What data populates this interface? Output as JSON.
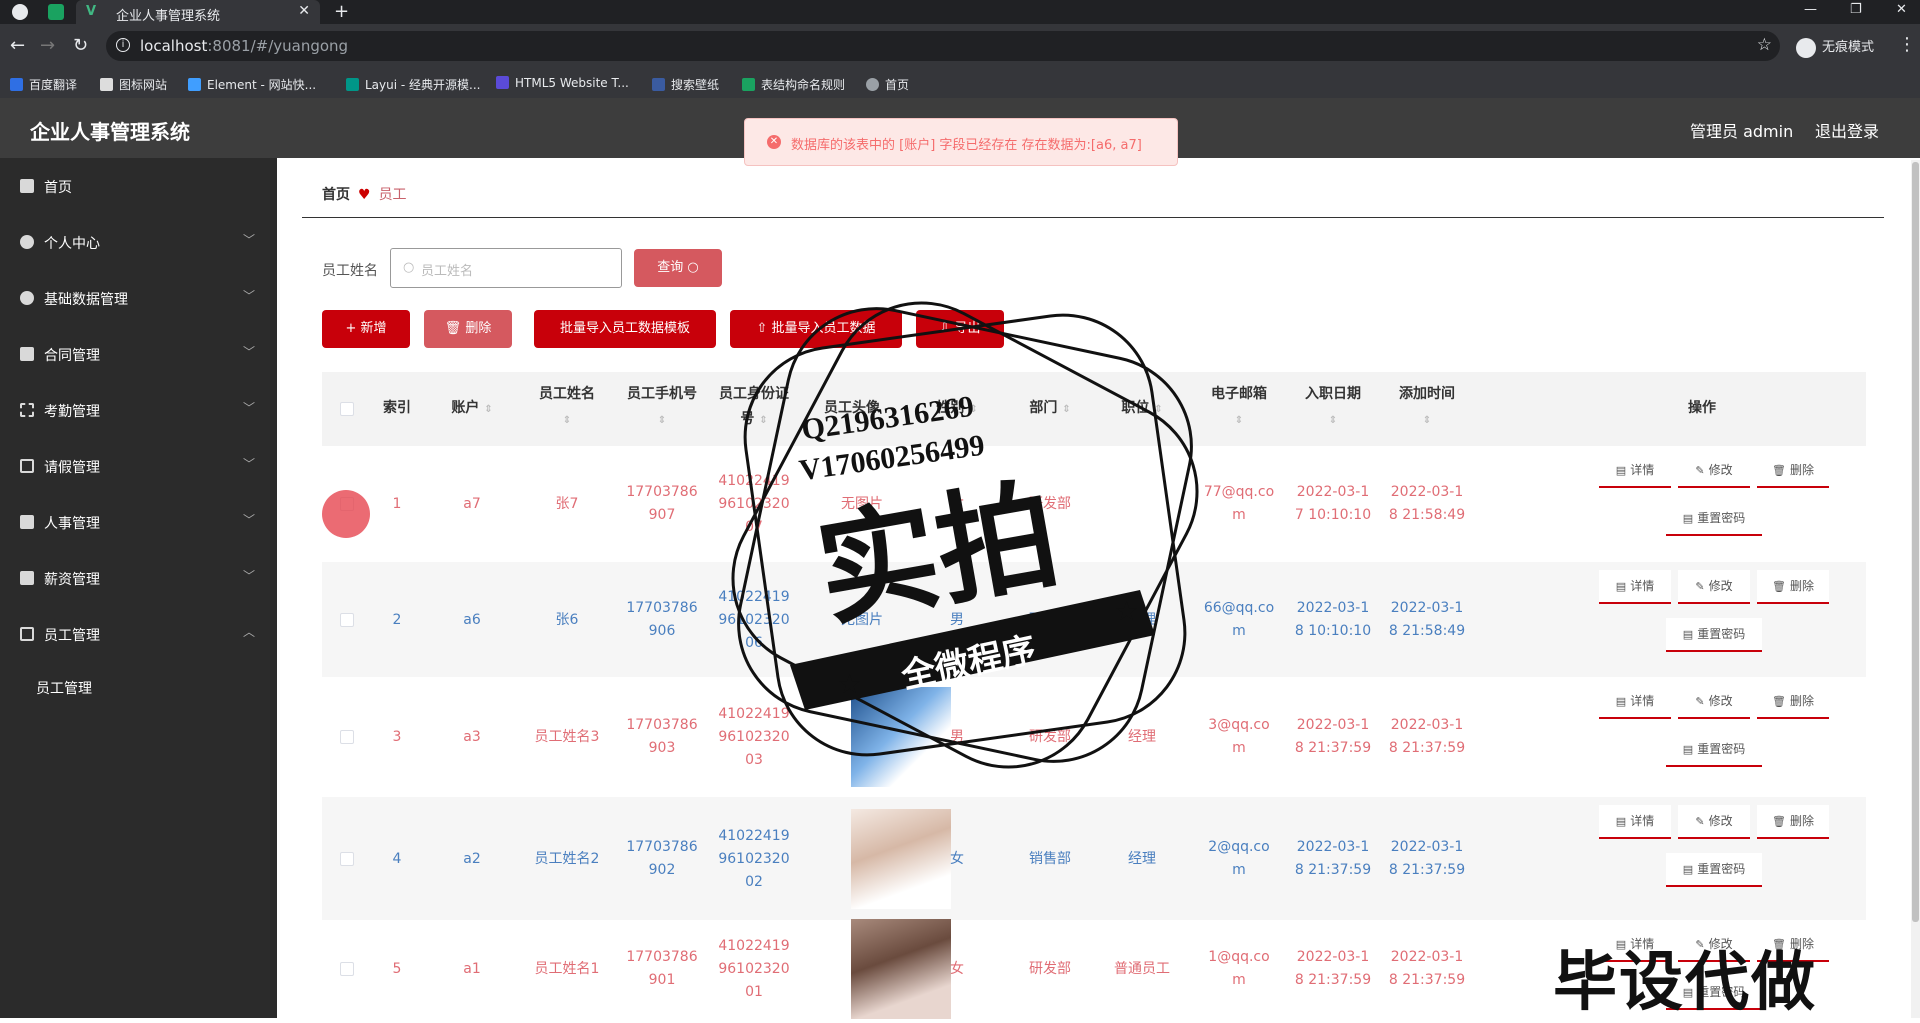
{
  "browser": {
    "tab_title": "企业人事管理系统",
    "tab_close": "✕",
    "new_tab": "+",
    "url_host": "localhost",
    "url_path": ":8081/#/yuangong",
    "incognito_label": "无痕模式",
    "window_controls": [
      "—",
      "❐",
      "✕"
    ],
    "bookmarks": [
      {
        "label": "百度翻译",
        "color": "#2f6fe4"
      },
      {
        "label": "图标网站",
        "color": "#222222"
      },
      {
        "label": "Element - 网站快...",
        "color": "#409eff"
      },
      {
        "label": "Layui - 经典开源模...",
        "color": "#009688"
      },
      {
        "label": "HTML5 Website T...",
        "color": "#5b4bd8"
      },
      {
        "label": "搜索壁纸",
        "color": "#3a5ba0"
      },
      {
        "label": "表结构命名规则",
        "color": "#1aa260"
      },
      {
        "label": "首页",
        "color": "#9aa0a6"
      }
    ]
  },
  "app": {
    "title": "企业人事管理系统",
    "admin": "管理员 admin",
    "logout": "退出登录"
  },
  "toast": {
    "message": "数据库的该表中的 [账户] 字段已经存在 存在数据为:[a6, a7]",
    "color": "#f56c6c"
  },
  "sidebar": {
    "items": [
      {
        "label": "首页"
      },
      {
        "label": "个人中心"
      },
      {
        "label": "基础数据管理"
      },
      {
        "label": "合同管理"
      },
      {
        "label": "考勤管理"
      },
      {
        "label": "请假管理"
      },
      {
        "label": "人事管理"
      },
      {
        "label": "薪资管理"
      },
      {
        "label": "员工管理"
      }
    ],
    "sub_items": [
      {
        "label": "员工管理"
      }
    ]
  },
  "breadcrumb": {
    "home": "首页",
    "separator": "♥",
    "current": "员工"
  },
  "search": {
    "label": "员工姓名",
    "placeholder": "员工姓名",
    "query_button": "查询"
  },
  "toolbar": {
    "add": "+ 新增",
    "delete": "删除",
    "import_template": "批量导入员工数据模板",
    "import_data": "批量导入员工数据",
    "export": "导出"
  },
  "table": {
    "headers": [
      "索引",
      "账户",
      "员工姓名",
      "员工手机号",
      "员工身份证号",
      "员工头像",
      "性别",
      "部门",
      "职位",
      "电子邮箱",
      "入职日期",
      "添加时间",
      "操作"
    ],
    "rows": [
      {
        "index": "1",
        "account": "a7",
        "name": "张7",
        "phone": [
          "17703786",
          "907"
        ],
        "idcard": [
          "41022419",
          "96102320",
          "07"
        ],
        "avatar": "无图片",
        "gender": "女",
        "dept": "研发部",
        "position": "",
        "email": [
          "77@qq.co",
          "m"
        ],
        "hire": [
          "2022-03-1",
          "7 10:10:10"
        ],
        "added": [
          "2022-03-1",
          "8 21:58:49"
        ],
        "tone": "red"
      },
      {
        "index": "2",
        "account": "a6",
        "name": "张6",
        "phone": [
          "17703786",
          "906"
        ],
        "idcard": [
          "41022419",
          "96102320",
          "06"
        ],
        "avatar": "无图片",
        "gender": "男",
        "dept": "研发部",
        "position": "经理",
        "email": [
          "66@qq.co",
          "m"
        ],
        "hire": [
          "2022-03-1",
          "8 10:10:10"
        ],
        "added": [
          "2022-03-1",
          "8 21:58:49"
        ],
        "tone": "blue"
      },
      {
        "index": "3",
        "account": "a3",
        "name": "员工姓名3",
        "phone": [
          "17703786",
          "903"
        ],
        "idcard": [
          "41022419",
          "96102320",
          "03"
        ],
        "avatar": "",
        "gender": "男",
        "dept": "研发部",
        "position": "经理",
        "email": [
          "3@qq.co",
          "m"
        ],
        "hire": [
          "2022-03-1",
          "8 21:37:59"
        ],
        "added": [
          "2022-03-1",
          "8 21:37:59"
        ],
        "tone": "red"
      },
      {
        "index": "4",
        "account": "a2",
        "name": "员工姓名2",
        "phone": [
          "17703786",
          "902"
        ],
        "idcard": [
          "41022419",
          "96102320",
          "02"
        ],
        "avatar": "",
        "gender": "女",
        "dept": "销售部",
        "position": "经理",
        "email": [
          "2@qq.co",
          "m"
        ],
        "hire": [
          "2022-03-1",
          "8 21:37:59"
        ],
        "added": [
          "2022-03-1",
          "8 21:37:59"
        ],
        "tone": "blue"
      },
      {
        "index": "5",
        "account": "a1",
        "name": "员工姓名1",
        "phone": [
          "17703786",
          "901"
        ],
        "idcard": [
          "41022419",
          "96102320",
          "01"
        ],
        "avatar": "",
        "gender": "女",
        "dept": "研发部",
        "position": "普通员工",
        "email": [
          "1@qq.co",
          "m"
        ],
        "hire": [
          "2022-03-1",
          "8 21:37:59"
        ],
        "added": [
          "2022-03-1",
          "8 21:37:59"
        ],
        "tone": "red"
      }
    ],
    "actions": {
      "detail": "详情",
      "edit": "修改",
      "delete": "删除",
      "reset": "重置密码"
    }
  },
  "watermark": {
    "contact_q": "Q2196316269",
    "contact_v": "V17060256499",
    "big": "实拍",
    "ribbon": "全微程序",
    "bottom": "毕设代做"
  },
  "colors": {
    "primary": "#c8000a",
    "pink": "#d5595f",
    "header": "#3d3d3d",
    "sidebar": "#2b2b2b"
  }
}
